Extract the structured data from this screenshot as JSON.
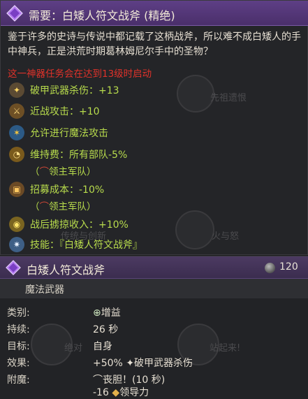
{
  "top_tooltip": {
    "title": "需要：白矮人符文战斧 (精绝)",
    "description": "鉴于许多的史诗与传说中都记载了这柄战斧，所以难不成白矮人的手中神兵，正是洪荒时期葛林姆尼尔手中的圣物？",
    "warning": "这一神器任务会在达到13级时启动",
    "background_labels": [
      "先祖遗恨",
      "传统与创新",
      "火与怒"
    ],
    "effects": [
      {
        "icon": "armor-piercing-icon",
        "text": "破甲武器杀伤：+13"
      },
      {
        "icon": "sword-icon",
        "text": "近战攻击：+10"
      },
      {
        "icon": "magic-attack-icon",
        "text": "允许进行魔法攻击"
      },
      {
        "icon": "upkeep-icon",
        "text": "维持费：所有部队-5%",
        "sub": "领主军队"
      },
      {
        "icon": "recruit-cost-icon",
        "text": "招募成本：-10%",
        "sub": "领主军队"
      },
      {
        "icon": "loot-icon",
        "text": "战后掳掠收入：+10%"
      },
      {
        "icon": "ability-icon",
        "text": "技能：『白矮人符文战斧』"
      }
    ],
    "sub_open": "（",
    "sub_close": "）"
  },
  "bottom_tooltip": {
    "name": "白矮人符文战斧",
    "cost": "120",
    "type": "魔法武器",
    "background_labels": [
      "绝对",
      "站起来!"
    ],
    "rows": [
      {
        "key": "类别:",
        "value": "增益"
      },
      {
        "key": "持续:",
        "value": "26 秒"
      },
      {
        "key": "目标:",
        "value": "自身"
      },
      {
        "key": "效果:",
        "value_green": "+50%",
        "value_rest": "破甲武器杀伤"
      },
      {
        "key": "附魔:",
        "value_line1": "丧胆！(10 秒)",
        "value_line2_num": "-16",
        "value_line2_rest": "领导力"
      }
    ]
  },
  "colors": {
    "title_purple": "#5e3f86",
    "effect_green": "#b8dc4c",
    "warning_red": "#e0322a"
  }
}
